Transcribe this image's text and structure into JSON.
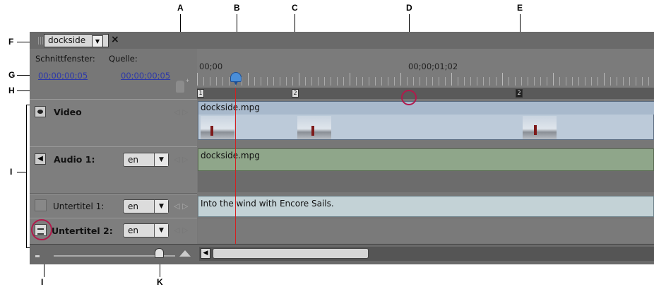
{
  "callouts": {
    "A": "A",
    "B": "B",
    "C": "C",
    "D": "D",
    "E": "E",
    "F": "F",
    "G": "G",
    "H": "H",
    "I_left": "I",
    "I_bottom": "I",
    "K": "K"
  },
  "tab": {
    "title": "dockside",
    "menu_arrow": "▼",
    "close": "×"
  },
  "header": {
    "timeline_label": "Schnittfenster:",
    "source_label": "Quelle:",
    "timeline_timecode": "00;00;00;05",
    "source_timecode": "00;00;00;05"
  },
  "ruler": {
    "start_time": "00;00",
    "mid_time": "00;00;01;02",
    "chapter_c": "2",
    "chapter_e": "2",
    "marker_start": "1"
  },
  "tracks": {
    "video": {
      "name": "Video",
      "clip": "dockside.mpg"
    },
    "audio1": {
      "name": "Audio 1:",
      "lang": "en",
      "clip": "dockside.mpg"
    },
    "sub1": {
      "name": "Untertitel 1:",
      "lang": "en",
      "text": "Into the wind with Encore Sails."
    },
    "sub2": {
      "name": "Untertitel 2:",
      "lang": "en"
    }
  },
  "colors": {
    "video_clip": "#bccad9",
    "audio_clip": "#8fa68a",
    "subtitle_clip": "#c3d2d6",
    "playhead": "#d42020",
    "timecode_link": "#2d39a8",
    "callout_circle": "#b21a4c"
  },
  "icons": {
    "drag_handle": "drag-handle-icon",
    "video_eye": "eye-icon",
    "audio_speaker": "speaker-icon",
    "subtitle_active": "subtitle-icon",
    "zoom_small": "zoom-out-icon",
    "zoom_large": "zoom-in-icon"
  }
}
